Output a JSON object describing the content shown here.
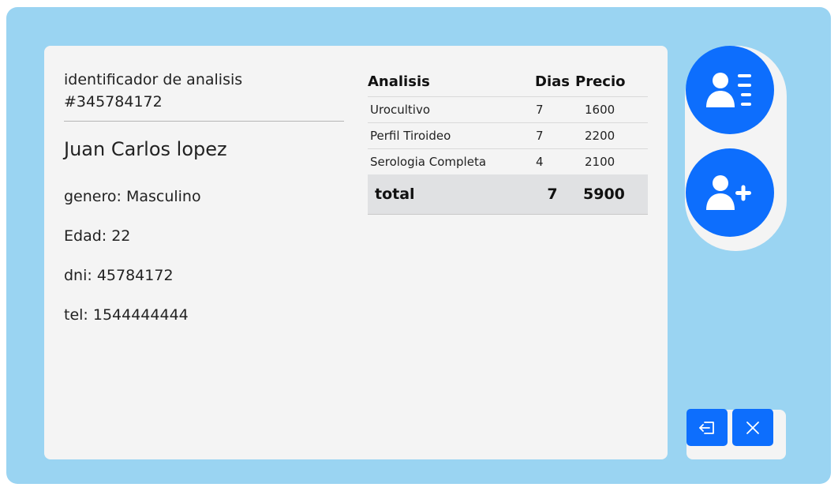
{
  "analysis": {
    "id_label": "identificador de analisis",
    "id_number": "#345784172"
  },
  "patient": {
    "name": "Juan Carlos lopez",
    "gender": "genero: Masculino",
    "age": "Edad: 22",
    "dni": "dni: 45784172",
    "tel": "tel: 1544444444"
  },
  "table": {
    "headers": [
      "Analisis",
      "Dias",
      "Precio"
    ],
    "rows": [
      [
        "Urocultivo",
        "7",
        "1600"
      ],
      [
        "Perfil Tiroideo",
        "7",
        "2200"
      ],
      [
        "Serologia Completa",
        "4",
        "2100"
      ]
    ],
    "total": [
      "total",
      "7",
      "5900"
    ]
  },
  "actions": {
    "patient_list_icon": "user-list-icon",
    "add_patient_icon": "user-plus-icon",
    "exit_icon": "sign-out-icon",
    "close_icon": "x-icon"
  },
  "colors": {
    "accent": "#0d6efd",
    "background": "#9ad4f2",
    "card": "#f4f4f4",
    "total_row": "#e0e1e3"
  }
}
